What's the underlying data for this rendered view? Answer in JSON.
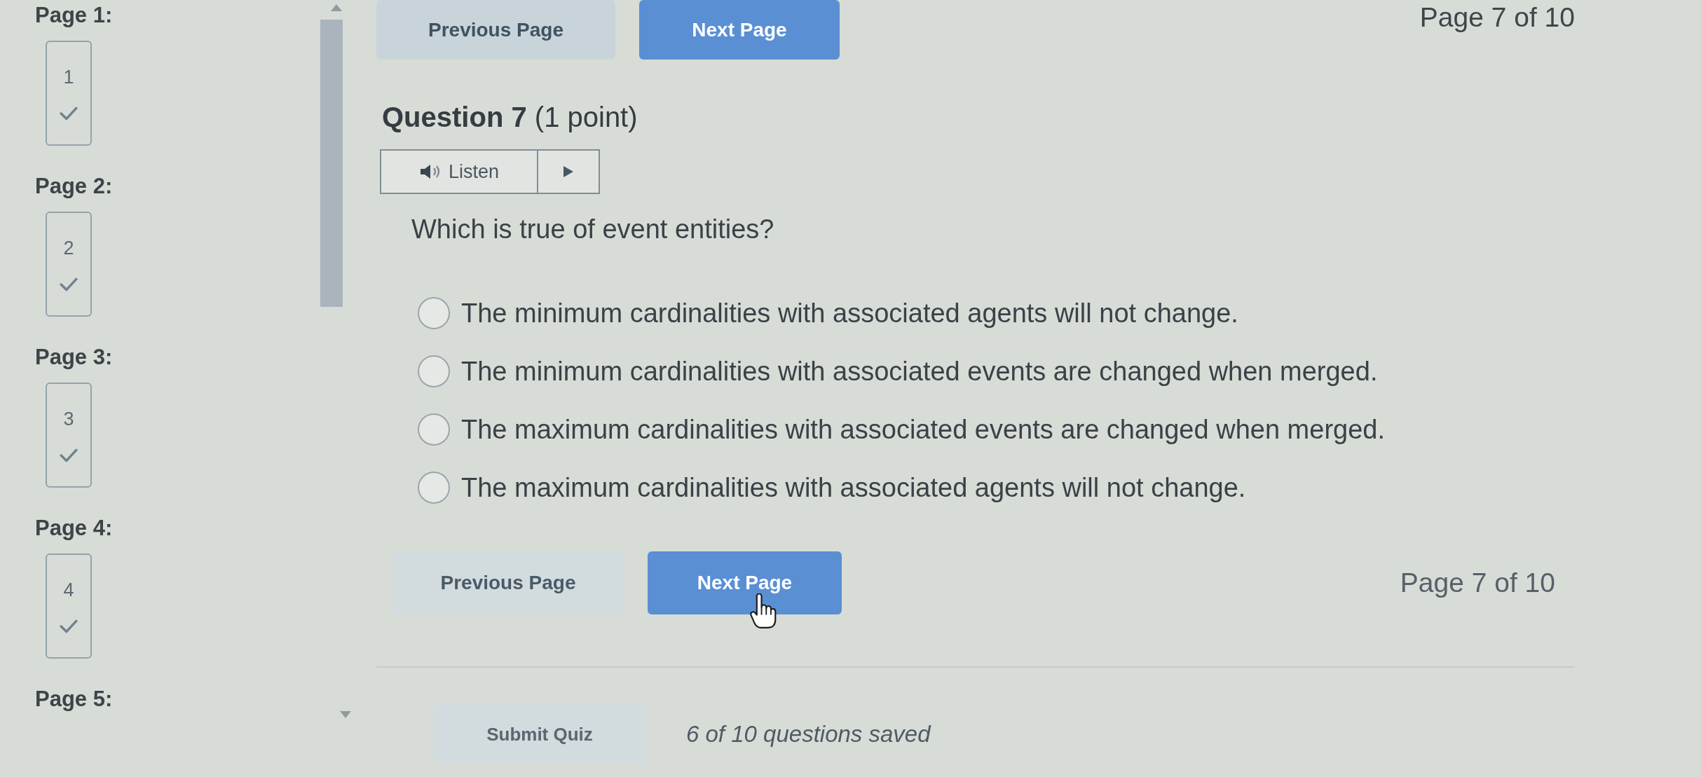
{
  "sidebar": {
    "pages": [
      {
        "label": "Page 1:",
        "questions": [
          {
            "number": "1",
            "answered": true
          }
        ]
      },
      {
        "label": "Page 2:",
        "questions": [
          {
            "number": "2",
            "answered": true
          }
        ]
      },
      {
        "label": "Page 3:",
        "questions": [
          {
            "number": "3",
            "answered": true
          }
        ]
      },
      {
        "label": "Page 4:",
        "questions": [
          {
            "number": "4",
            "answered": true
          }
        ]
      },
      {
        "label": "Page 5:"
      }
    ]
  },
  "top_nav": {
    "buttons": [
      {
        "kind": "previous",
        "label": "Previous Page"
      },
      {
        "kind": "next",
        "label": "Next Page"
      }
    ],
    "page_indicator": "Page 7 of 10"
  },
  "question": {
    "title": "**Question 7** (1 point)",
    "listen": {
      "label": "Listen"
    },
    "prompt": "Which is true of event entities?",
    "options": [
      {
        "text": "The minimum cardinalities with associated agents will not change.",
        "selected": false
      },
      {
        "text": "The minimum cardinalities with associated events are changed when merged.",
        "selected": false
      },
      {
        "text": "The maximum cardinalities with associated events are changed when merged.",
        "selected": false
      },
      {
        "text": "The maximum cardinalities with associated agents will not change.",
        "selected": false
      }
    ]
  },
  "bottom_nav": {
    "buttons": [
      {
        "kind": "previous",
        "label": "Previous Page"
      },
      {
        "kind": "next",
        "label": "Next Page"
      }
    ],
    "page_indicator": "Page 7 of 10"
  },
  "footer": {
    "submit": "Submit Quiz",
    "status": "6 of 10 questions saved"
  }
}
